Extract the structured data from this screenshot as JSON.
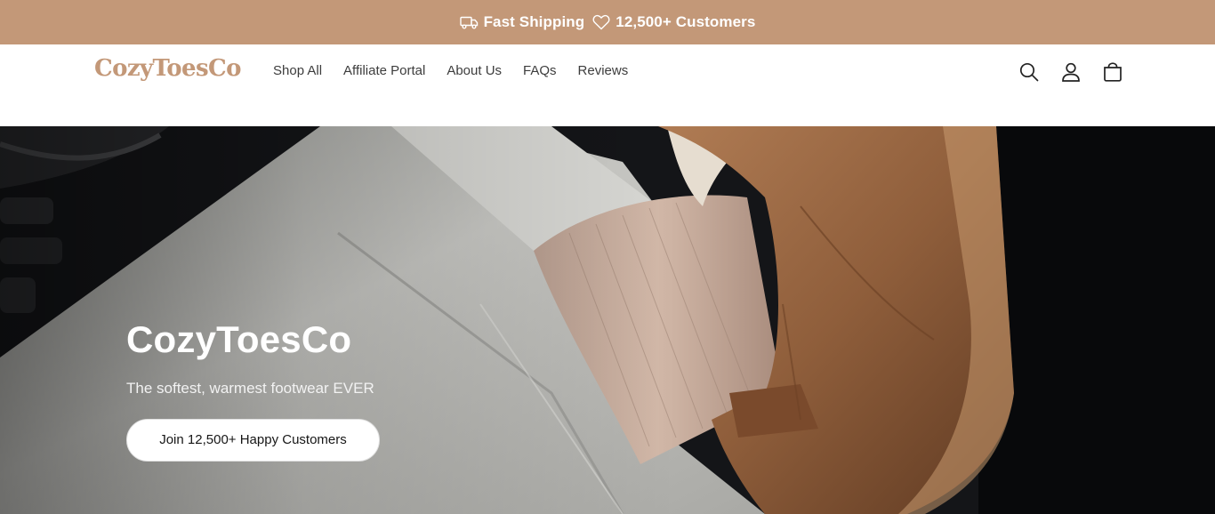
{
  "announcement": {
    "shipping_icon": "truck-icon",
    "shipping_text": "Fast Shipping",
    "customers_icon": "heart-icon",
    "customers_text": "12,500+ Customers"
  },
  "header": {
    "logo": "CozyToesCo",
    "nav": [
      "Shop All",
      "Affiliate Portal",
      "About Us",
      "FAQs",
      "Reviews"
    ],
    "icons": [
      "search-icon",
      "account-icon",
      "cart-icon"
    ]
  },
  "hero": {
    "title": "CozyToesCo",
    "subtitle": "The softest, warmest footwear EVER",
    "cta": "Join 12,500+ Happy Customers"
  },
  "colors": {
    "brand": "#c39878",
    "announcement_bg": "#c39878",
    "nav_text": "#3d3d3d",
    "hero_text": "#ffffff"
  }
}
